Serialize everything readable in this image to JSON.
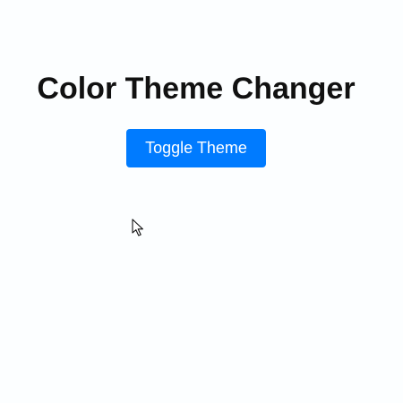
{
  "page": {
    "title": "Color Theme Changer",
    "background_color": "#fcfeff"
  },
  "toggle_button": {
    "label": "Toggle Theme",
    "color": "#007bff",
    "text_color": "#ffffff"
  },
  "cursor": {
    "icon": "mouse-pointer-icon"
  }
}
